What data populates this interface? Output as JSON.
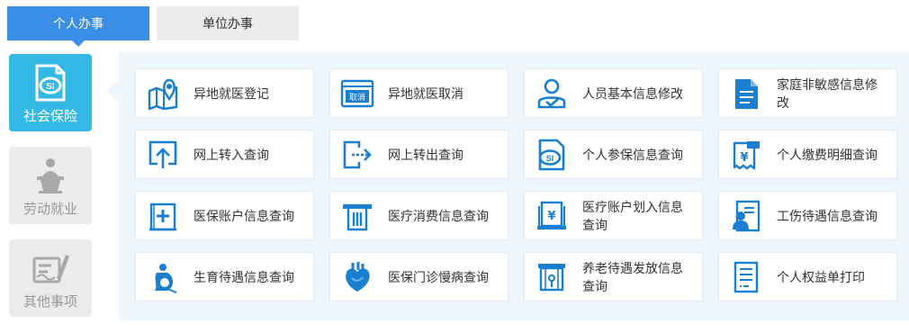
{
  "tabs": {
    "personal": "个人办事",
    "unit": "单位办事"
  },
  "sidebar": {
    "items": [
      {
        "label": "社会保险",
        "icon": "social-insurance-icon",
        "active": true
      },
      {
        "label": "劳动就业",
        "icon": "speaker-podium-icon",
        "active": false
      },
      {
        "label": "其他事项",
        "icon": "sign-document-icon",
        "active": false
      }
    ]
  },
  "services": [
    {
      "label": "异地就医登记",
      "icon": "map-pin-icon"
    },
    {
      "label": "异地就医取消",
      "icon": "cancel-window-icon"
    },
    {
      "label": "人员基本信息修改",
      "icon": "user-check-icon"
    },
    {
      "label": "家庭非敏感信息修改",
      "icon": "document-icon"
    },
    {
      "label": "网上转入查询",
      "icon": "upload-arrow-icon"
    },
    {
      "label": "网上转出查询",
      "icon": "export-arrow-icon"
    },
    {
      "label": "个人参保信息查询",
      "icon": "si-document-icon"
    },
    {
      "label": "个人缴费明细查询",
      "icon": "payment-receipt-icon"
    },
    {
      "label": "医保账户信息查询",
      "icon": "medical-box-icon"
    },
    {
      "label": "医疗消费信息查询",
      "icon": "atm-slot-icon"
    },
    {
      "label": "医疗账户划入信息查询",
      "icon": "yen-transfer-icon"
    },
    {
      "label": "工伤待遇信息查询",
      "icon": "worker-card-icon"
    },
    {
      "label": "生育待遇信息查询",
      "icon": "pregnancy-icon"
    },
    {
      "label": "医保门诊慢病查询",
      "icon": "heart-organ-icon"
    },
    {
      "label": "养老待遇发放信息查询",
      "icon": "pension-frame-icon"
    },
    {
      "label": "个人权益单打印",
      "icon": "print-record-icon"
    }
  ],
  "colors": {
    "accent": "#3a8ee6",
    "sidebar_active": "#34b8e4",
    "icon_blue": "#1a7fd1",
    "panel_bg": "#eef6fc"
  }
}
